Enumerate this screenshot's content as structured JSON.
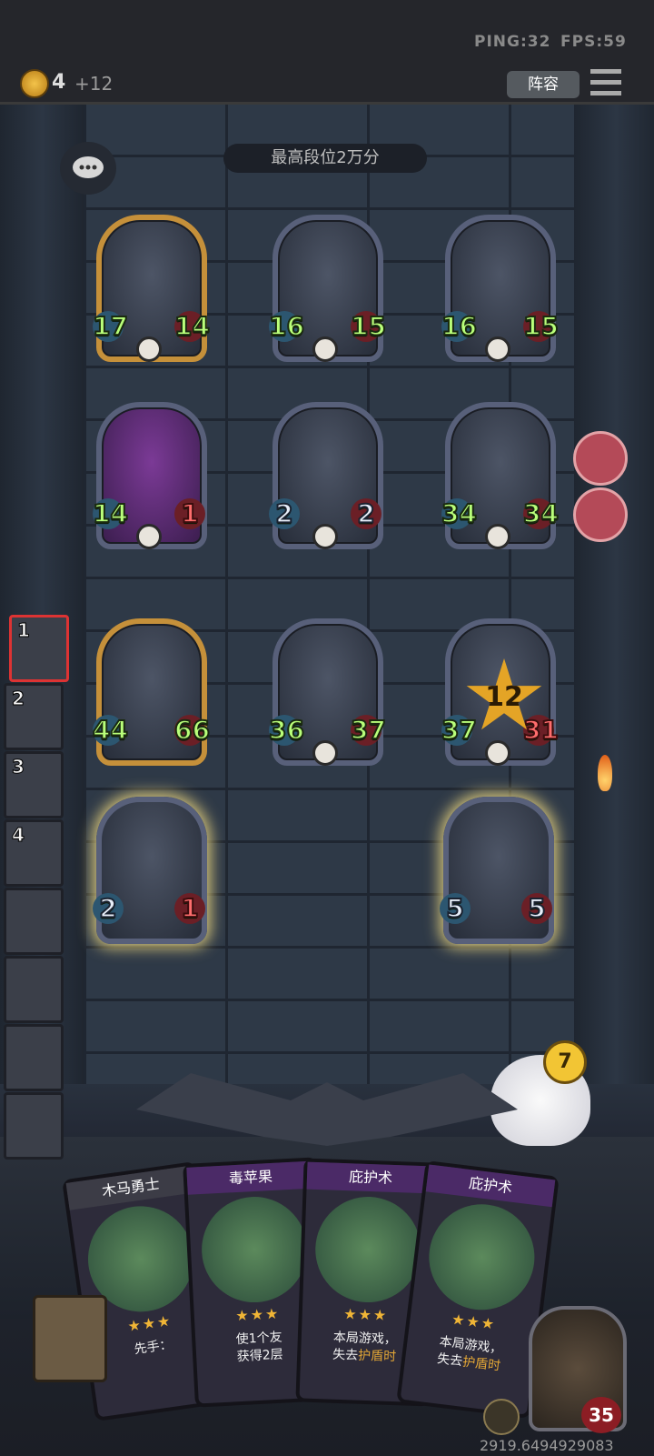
{
  "status": {
    "ping": "PING:32",
    "fps": "FPS:59"
  },
  "currency": {
    "gold": "4",
    "income": "+12"
  },
  "lineup_button": {
    "label": "阵容"
  },
  "banner": "最高段位2万分",
  "board": [
    {
      "row": 1,
      "atk": "17",
      "hp": "14",
      "frame": "gold"
    },
    {
      "row": 1,
      "atk": "16",
      "hp": "15",
      "frame": "silver"
    },
    {
      "row": 1,
      "atk": "16",
      "hp": "15",
      "frame": "silver"
    },
    {
      "row": 2,
      "atk": "14",
      "hp": "1",
      "frame": "purple"
    },
    {
      "row": 2,
      "atk": "2",
      "hp": "2",
      "frame": "silver"
    },
    {
      "row": 2,
      "atk": "34",
      "hp": "34",
      "frame": "silver"
    },
    {
      "row": 3,
      "atk": "44",
      "hp": "66",
      "frame": "gold"
    },
    {
      "row": 3,
      "atk": "36",
      "hp": "37",
      "frame": "silver"
    },
    {
      "row": 3,
      "atk": "37",
      "hp": "31",
      "frame": "silver",
      "badge": "12"
    },
    {
      "row": 4,
      "atk": "2",
      "hp": "1",
      "frame": "glow"
    },
    {
      "row": 4,
      "atk": "5",
      "hp": "5",
      "frame": "glow"
    }
  ],
  "opponents": [
    {
      "rank": "1"
    },
    {
      "rank": "2"
    },
    {
      "rank": "3"
    },
    {
      "rank": "4"
    },
    {
      "rank": ""
    },
    {
      "rank": ""
    },
    {
      "rank": ""
    },
    {
      "rank": ""
    }
  ],
  "pet_badge": "7",
  "hand": [
    {
      "name": "木马勇士",
      "stars": "★★★",
      "desc_a": "先手：",
      "desc_b": "",
      "desc_c": ""
    },
    {
      "name": "毒苹果",
      "stars": "★★★",
      "desc_a": "使1个友",
      "desc_b": "获得2层",
      "desc_c": ""
    },
    {
      "name": "庇护术",
      "stars": "★★★",
      "desc_a": "本局游戏，",
      "desc_b": "失去",
      "desc_c": "护盾时"
    },
    {
      "name": "庇护术",
      "stars": "★★★",
      "desc_a": "本局游戏，",
      "desc_b": "失去",
      "desc_c": "护盾时"
    }
  ],
  "player": {
    "hp": "35"
  },
  "footer_id": "2919.6494929083"
}
